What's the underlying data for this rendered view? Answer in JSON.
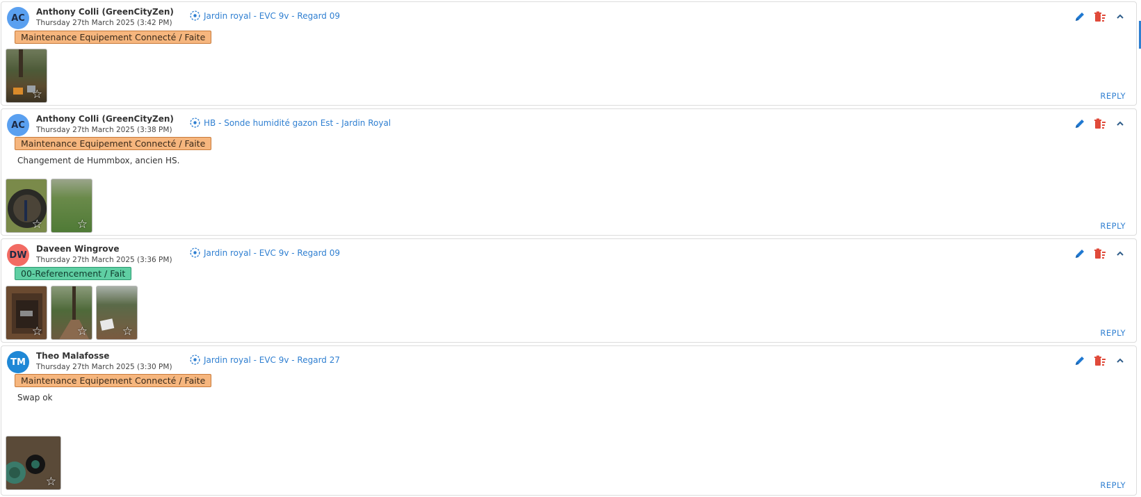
{
  "posts": [
    {
      "initials": "AC",
      "avatar_color": "#5aa0f0",
      "author": "Anthony Colli (GreenCityZen)",
      "date": "Thursday 27th March 2025 (3:42 PM)",
      "location": "Jardin royal - EVC 9v - Regard 09",
      "tag": "Maintenance Equipement Connecté / Faite",
      "tag_color": "orange",
      "comment": "",
      "images": [
        {
          "alt": "garden-equipment-photo"
        }
      ],
      "reply_label": "REPLY"
    },
    {
      "initials": "AC",
      "avatar_color": "#5aa0f0",
      "author": "Anthony Colli (GreenCityZen)",
      "date": "Thursday 27th March 2025 (3:38 PM)",
      "location": "HB - Sonde humidité gazon Est - Jardin Royal",
      "tag": "Maintenance Equipement Connecté / Faite",
      "tag_color": "orange",
      "comment": "Changement de Hummbox, ancien HS.",
      "images": [
        {
          "alt": "manhole-photo"
        },
        {
          "alt": "lawn-photo"
        }
      ],
      "reply_label": "REPLY"
    },
    {
      "initials": "DW",
      "avatar_color": "#f26b63",
      "author": "Daveen Wingrove",
      "date": "Thursday 27th March 2025 (3:36 PM)",
      "location": "Jardin royal - EVC 9v - Regard 09",
      "tag": "00-Referencement / Fait",
      "tag_color": "green",
      "comment": "",
      "images": [
        {
          "alt": "valve-box-photo"
        },
        {
          "alt": "path-photo"
        },
        {
          "alt": "sign-photo"
        }
      ],
      "reply_label": "REPLY"
    },
    {
      "initials": "TM",
      "avatar_color": "#1f88d6",
      "author": "Theo Malafosse",
      "date": "Thursday 27th March 2025 (3:30 PM)",
      "location": "Jardin royal - EVC 9v - Regard 27",
      "tag": "Maintenance Equipement Connecté / Faite",
      "tag_color": "orange",
      "comment": "Swap ok",
      "images": [
        {
          "alt": "sensor-ground-photo"
        }
      ],
      "reply_label": "REPLY"
    }
  ],
  "colors": {
    "accent": "#2f7fd1",
    "delete": "#e04a3a",
    "edit": "#1f78d1"
  }
}
